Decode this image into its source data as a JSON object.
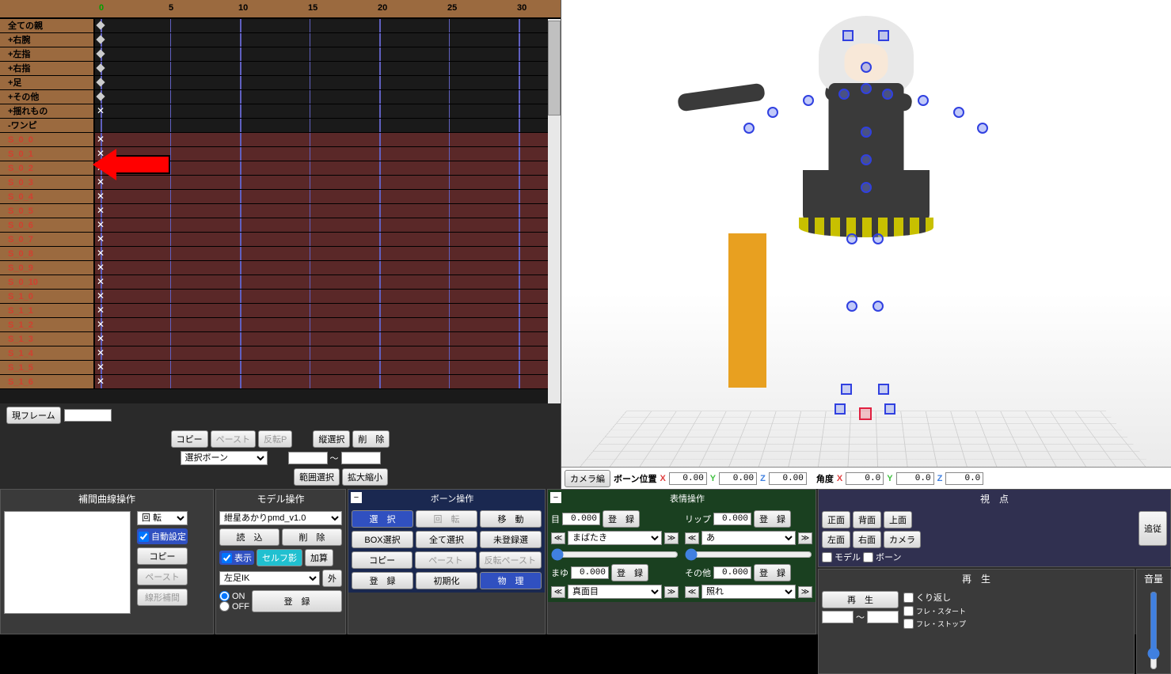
{
  "timeline": {
    "ruler_ticks": [
      "0",
      "5",
      "10",
      "15",
      "20",
      "25",
      "30"
    ],
    "tracks": [
      {
        "label": "全ての親",
        "type": "group",
        "key": "diamond"
      },
      {
        "label": "+右腕",
        "type": "group",
        "key": "diamond"
      },
      {
        "label": "+左指",
        "type": "group",
        "key": "diamond"
      },
      {
        "label": "+右指",
        "type": "group",
        "key": "diamond"
      },
      {
        "label": "+足",
        "type": "group",
        "key": "diamond"
      },
      {
        "label": "+その他",
        "type": "group",
        "key": "diamond"
      },
      {
        "label": "+揺れもの",
        "type": "group",
        "key": "xspecial"
      },
      {
        "label": "-ワンピ",
        "type": "group",
        "key": ""
      },
      {
        "label": "S_0_0",
        "type": "bone",
        "key": "x"
      },
      {
        "label": "S_0_1",
        "type": "bone",
        "key": "x"
      },
      {
        "label": "S_0_2",
        "type": "bone",
        "key": "x"
      },
      {
        "label": "S_0_3",
        "type": "bone",
        "key": "x"
      },
      {
        "label": "S_0_4",
        "type": "bone",
        "key": "x"
      },
      {
        "label": "S_0_5",
        "type": "bone",
        "key": "x"
      },
      {
        "label": "S_0_6",
        "type": "bone",
        "key": "x"
      },
      {
        "label": "S_0_7",
        "type": "bone",
        "key": "x"
      },
      {
        "label": "S_0_8",
        "type": "bone",
        "key": "x"
      },
      {
        "label": "S_0_9",
        "type": "bone",
        "key": "x"
      },
      {
        "label": "S_0_10",
        "type": "bone",
        "key": "x"
      },
      {
        "label": "S_1_0",
        "type": "bone",
        "key": "x"
      },
      {
        "label": "S_1_1",
        "type": "bone",
        "key": "x"
      },
      {
        "label": "S_1_2",
        "type": "bone",
        "key": "x"
      },
      {
        "label": "S_1_3",
        "type": "bone",
        "key": "x"
      },
      {
        "label": "S_1_4",
        "type": "bone",
        "key": "x"
      },
      {
        "label": "S_1_5",
        "type": "bone",
        "key": "x"
      },
      {
        "label": "S_1_6",
        "type": "bone",
        "key": "x"
      }
    ],
    "current_frame_btn": "現フレーム",
    "frame_input": "",
    "copy": "コピー",
    "paste": "ペースト",
    "reverse_p": "反転P",
    "col_select": "縦選択",
    "delete": "削　除",
    "select_bone_dropdown": "選択ボーン",
    "range_select": "範囲選択",
    "scale": "拡大縮小",
    "tilde": "～"
  },
  "viewport": {
    "camera_edit": "カメラ編",
    "bone_pos_label": "ボーン位置",
    "angle_label": "角度",
    "pos_x": "0.00",
    "pos_y": "0.00",
    "pos_z": "0.00",
    "ang_x": "0.0",
    "ang_y": "0.0",
    "ang_z": "0.0",
    "x": "X",
    "y": "Y",
    "z": "Z"
  },
  "interp": {
    "title": "補間曲線操作",
    "rotate": "回 転",
    "auto": "自動設定",
    "copy": "コピー",
    "paste": "ペースト",
    "linear": "線形補間"
  },
  "model": {
    "title": "モデル操作",
    "dropdown": "紲星あかりpmd_v1.0",
    "load": "読　込",
    "delete": "削　除",
    "show": "表示",
    "self_shadow": "セルフ影",
    "add": "加算",
    "ik_dropdown": "左足IK",
    "out": "外",
    "on": "ON",
    "off": "OFF",
    "register": "登　録"
  },
  "bone": {
    "title": "ボーン操作",
    "select": "選　択",
    "rotate": "回　転",
    "move": "移　動",
    "box_select": "BOX選択",
    "select_all": "全て選択",
    "unregistered": "未登録選",
    "copy": "コピー",
    "paste": "ペースト",
    "reverse_paste": "反転ペースト",
    "register": "登　録",
    "init": "初期化",
    "physics": "物　理"
  },
  "facial": {
    "title": "表情操作",
    "eye": "目",
    "lip": "リップ",
    "brow": "まゆ",
    "other": "その他",
    "register": "登　録",
    "val_eye": "0.000",
    "val_lip": "0.000",
    "val_brow": "0.000",
    "val_other": "0.000",
    "dd_eye": "まばたき",
    "dd_lip": "あ",
    "dd_brow": "真面目",
    "dd_other": "照れ"
  },
  "view": {
    "title": "視　点",
    "front": "正面",
    "back": "背面",
    "top": "上面",
    "left": "左面",
    "right": "右面",
    "camera": "カメラ",
    "follow": "追従",
    "model": "モデル",
    "bone": "ボーン"
  },
  "playback": {
    "title": "再　生",
    "play": "再　生",
    "repeat": "くり返し",
    "frame_start": "フレ・スタート",
    "frame_stop": "フレ・ストップ",
    "tilde": "～"
  },
  "volume": {
    "title": "音量"
  }
}
